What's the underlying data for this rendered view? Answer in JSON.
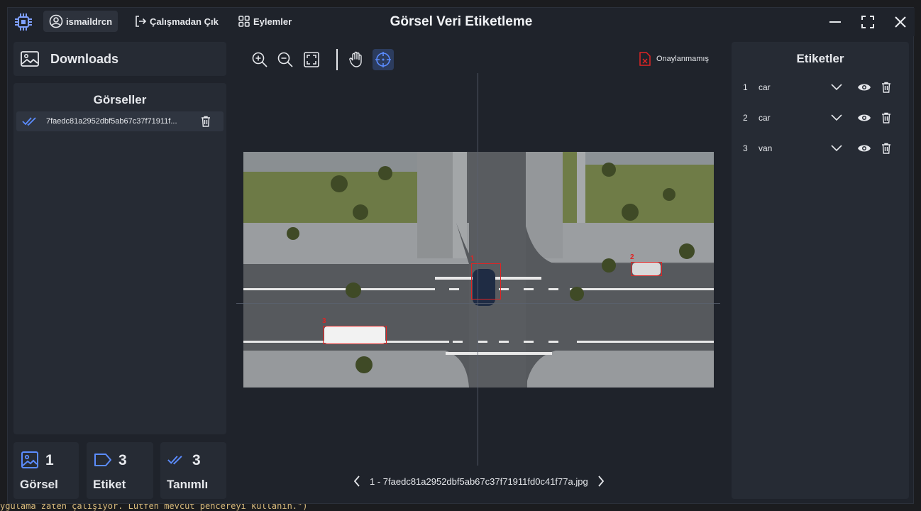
{
  "app": {
    "title": "Görsel Veri Etiketleme",
    "username": "ismaildrcn",
    "exit_label": "Çalışmadan Çık",
    "actions_label": "Eylemler",
    "accent": "#5b8cff",
    "danger": "#e02424"
  },
  "backdrop": {
    "status_line": "ygulama zaten çalışıyor. Lütfen mevcut pencereyi kullanın.\")"
  },
  "sidebar": {
    "folder": "Downloads",
    "images_title": "Görseller",
    "files": [
      {
        "name": "7faedc81a2952dbf5ab67c37f71911f...",
        "status": "labeled"
      }
    ]
  },
  "stats": {
    "images": {
      "value": "1",
      "label": "Görsel"
    },
    "labels": {
      "value": "3",
      "label": "Etiket"
    },
    "defined": {
      "value": "3",
      "label": "Tanımlı"
    }
  },
  "toolbar": {
    "tools": [
      "zoom-in",
      "zoom-out",
      "fit-screen",
      "pan",
      "crosshair"
    ],
    "active_tool": "crosshair",
    "approval_status": "Onaylanmamış"
  },
  "canvas": {
    "boxes": [
      {
        "id": "1"
      },
      {
        "id": "2"
      },
      {
        "id": "3"
      }
    ]
  },
  "pager": {
    "current": "1 - 7faedc81a2952dbf5ab67c37f71911fd0c41f77a.jpg"
  },
  "labels_panel": {
    "title": "Etiketler",
    "items": [
      {
        "index": "1",
        "name": "car"
      },
      {
        "index": "2",
        "name": "car"
      },
      {
        "index": "3",
        "name": "van"
      }
    ]
  }
}
